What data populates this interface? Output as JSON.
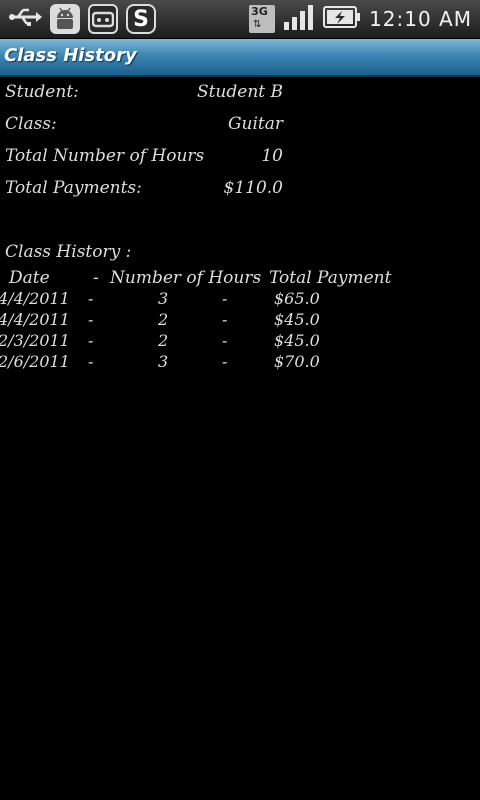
{
  "statusbar": {
    "time": "12:10 AM",
    "network": "3G",
    "icons": [
      "usb-icon",
      "android-debug-icon",
      "robot-face-icon",
      "skype-icon",
      "network-3g-icon",
      "signal-icon",
      "battery-charging-icon"
    ]
  },
  "titlebar": {
    "title": "Class History"
  },
  "summary": {
    "student_label": "Student:",
    "student_value": "Student B",
    "class_label": "Class:",
    "class_value": "Guitar",
    "hours_label": "Total Number of Hours",
    "hours_value": "10",
    "payments_label": "Total Payments:",
    "payments_value": "$110.0"
  },
  "history": {
    "title": "Class History :",
    "headers": {
      "date": "Date",
      "sep1": "-",
      "hours": "Number of Hours",
      "sep2": "-",
      "payment": "Total Payment"
    },
    "rows": [
      {
        "date": "4/4/2011",
        "sep1": "-",
        "hours": "3",
        "sep2": "-",
        "payment": "$65.0"
      },
      {
        "date": "4/4/2011",
        "sep1": "-",
        "hours": "2",
        "sep2": "-",
        "payment": "$45.0"
      },
      {
        "date": "2/3/2011",
        "sep1": "-",
        "hours": "2",
        "sep2": "-",
        "payment": "$45.0"
      },
      {
        "date": "2/6/2011",
        "sep1": "-",
        "hours": "3",
        "sep2": "-",
        "payment": "$70.0"
      }
    ]
  }
}
